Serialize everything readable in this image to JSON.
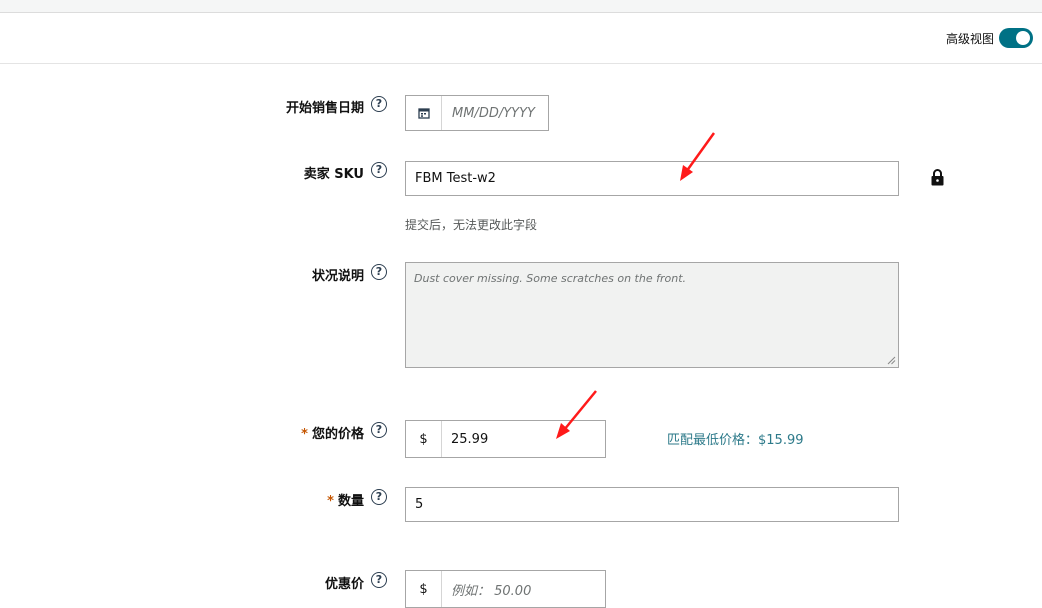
{
  "header": {
    "advanced_view_label": "高级视图",
    "advanced_view_on": true
  },
  "form": {
    "start_date": {
      "label": "开始销售日期",
      "placeholder": "MM/DD/YYYY"
    },
    "seller_sku": {
      "label": "卖家 SKU",
      "value": "FBM Test-w2",
      "hint": "提交后，无法更改此字段"
    },
    "condition_note": {
      "label": "状况说明",
      "value": "Dust cover missing. Some scratches on the front."
    },
    "your_price": {
      "required_mark": "*",
      "label": "您的价格",
      "currency": "$",
      "value": "25.99",
      "match_low_price": "匹配最低价格：$15.99"
    },
    "quantity": {
      "required_mark": "*",
      "label": "数量",
      "value": "5"
    },
    "sale_price": {
      "label": "优惠价",
      "currency": "$",
      "placeholder": "例如： 50.00"
    }
  },
  "colors": {
    "accent": "#007185",
    "arrow": "#ff1a1a",
    "link": "#2d7a8a"
  }
}
